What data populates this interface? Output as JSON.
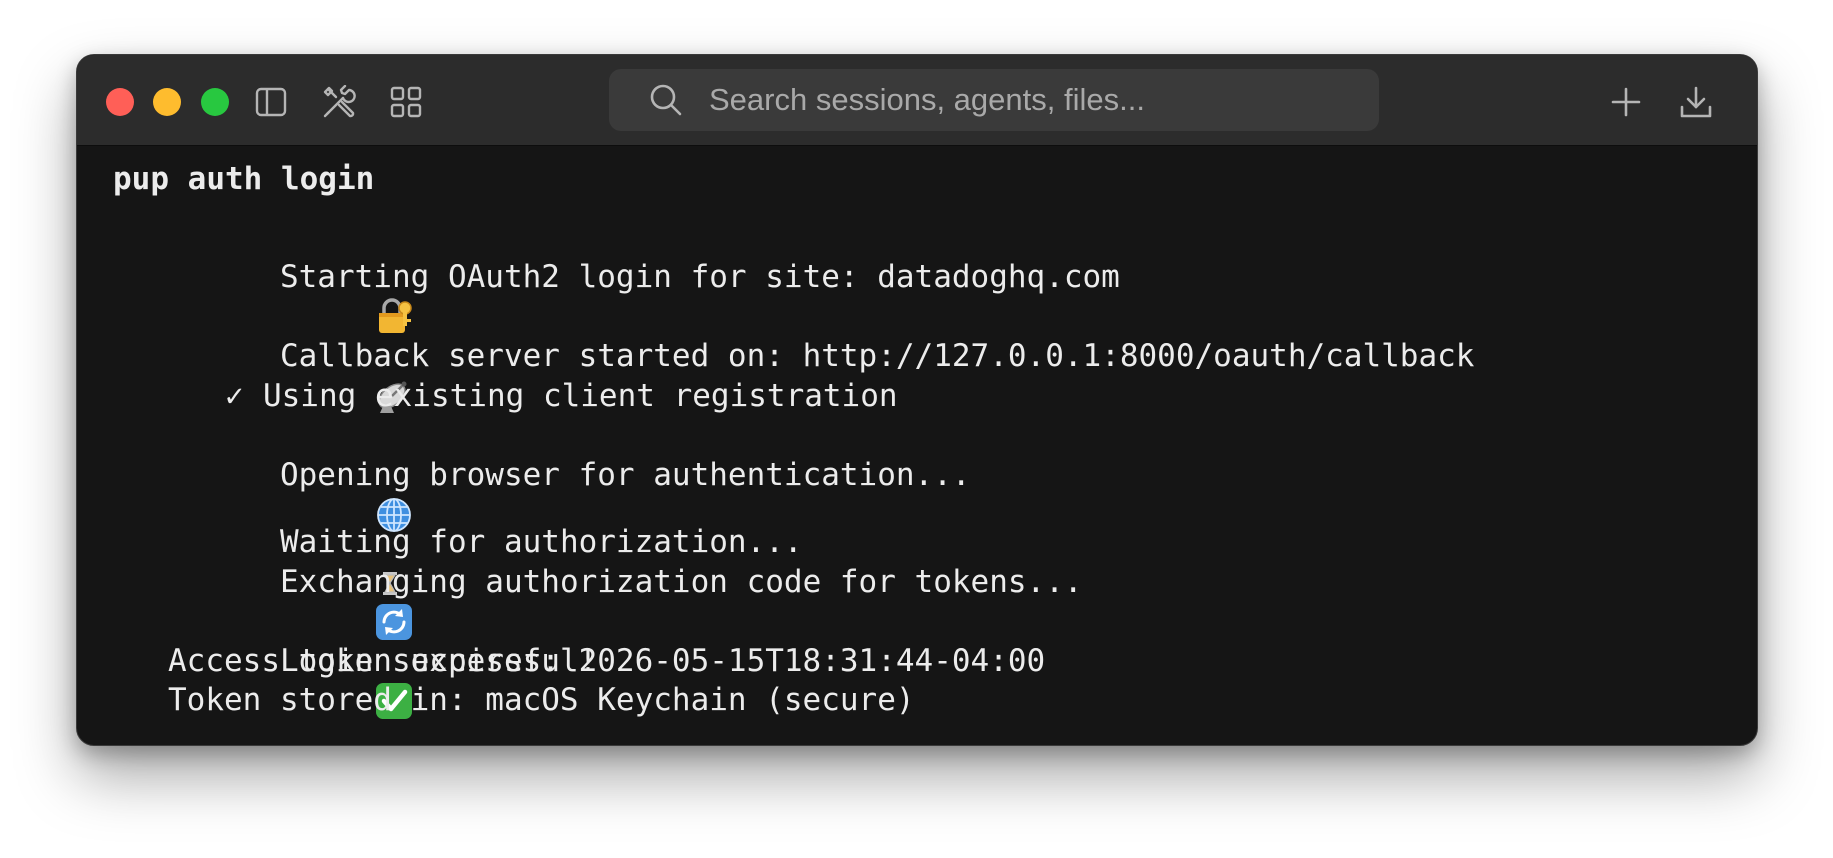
{
  "window": {
    "traffic_lights": [
      "close",
      "minimize",
      "maximize"
    ],
    "toolbar_icons": [
      "sidebar-icon",
      "tools-icon",
      "grid-icon"
    ],
    "search": {
      "placeholder": "Search sessions, agents, files..."
    },
    "right_icons": [
      "plus-icon",
      "download-icon"
    ]
  },
  "terminal": {
    "command": "pup auth login",
    "lines": [
      {
        "icon": "lock-key-icon",
        "text": "Starting OAuth2 login for site: datadoghq.com"
      },
      {
        "icon": "satellite-dish-icon",
        "text": "Callback server started on: http://127.0.0.1:8000/oauth/callback"
      },
      {
        "prefix": "✓",
        "text": "Using existing client registration"
      },
      {
        "icon": "globe-icon",
        "text": "Opening browser for authentication..."
      },
      {
        "icon": "hourglass-icon",
        "text": "Waiting for authorization..."
      },
      {
        "icon": "refresh-icon",
        "text": "Exchanging authorization code for tokens..."
      },
      {
        "icon": "check-mark-button-icon",
        "text": "Login successful!"
      },
      {
        "text": "Access token expires: 2026-05-15T18:31:44-04:00"
      },
      {
        "text": "Token stored in: macOS Keychain (secure)"
      }
    ]
  }
}
